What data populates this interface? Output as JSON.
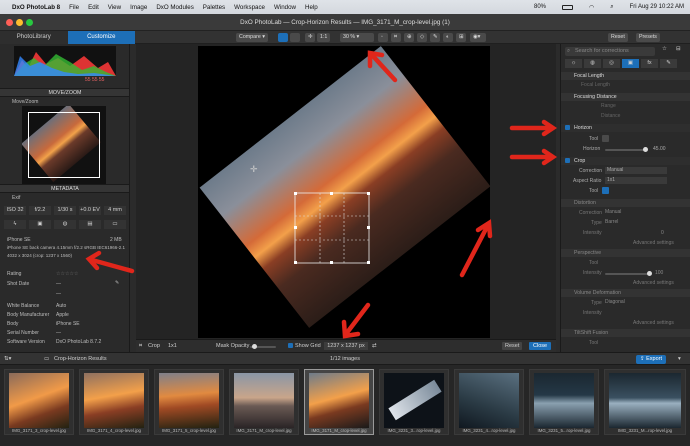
{
  "menubar": {
    "app": "DxO PhotoLab 8",
    "items": [
      "File",
      "Edit",
      "View",
      "Image",
      "DxO Modules",
      "Palettes",
      "Workspace",
      "Window",
      "Help"
    ],
    "battery": "80%",
    "clock": "Fri Aug 29  10:22 AM"
  },
  "window": {
    "title": "DxO PhotoLab — Crop-Horizon Results — IMG_3171_M_crop-level.jpg (1)"
  },
  "tabs": {
    "library": "PhotoLibrary",
    "customize": "Customize"
  },
  "toolbar": {
    "compare": "Compare",
    "one_to_one": "1:1",
    "zoom": "30 %",
    "reset": "Reset",
    "presets": "Presets"
  },
  "left": {
    "move_zoom": "MOVE/ZOOM",
    "move_zoom_sub": "Move/Zoom",
    "metadata": "METADATA",
    "exif": "Exif",
    "exif_values": [
      "ISO 32",
      "f/2.2",
      "1/30 s",
      "+0.0 EV",
      "4 mm"
    ],
    "camera": "iPhone SE",
    "size_mb": "2 MB",
    "lens": "iPhone SE back camera 4.15mm f/2.2",
    "colorspace": "sRGB IEC61966-2.1",
    "dims": "4032 x 3024 (crop: 1237 x 1560)",
    "histo_values": "55  55  55",
    "fields": [
      {
        "label": "Rating",
        "value": ""
      },
      {
        "label": "Shot Date",
        "value": "—"
      },
      {
        "label": "",
        "value": "—"
      },
      {
        "label": "White Balance",
        "value": "Auto"
      },
      {
        "label": "Body Manufacturer",
        "value": "Apple"
      },
      {
        "label": "Body",
        "value": "iPhone SE"
      },
      {
        "label": "Serial Number",
        "value": "—"
      },
      {
        "label": "Software Version",
        "value": "DxO PhotoLab 8.7.2"
      }
    ]
  },
  "right": {
    "search_placeholder": "Search for corrections",
    "focal": "Focal Length",
    "focal_row": "Focal Length",
    "focusing": "Focusing Distance",
    "focusing_rows": [
      "Range",
      "Distance"
    ],
    "horizon": "Horizon",
    "horizon_tool": "Tool",
    "horizon_label": "Horizon",
    "horizon_value": "45.00",
    "crop": "Crop",
    "crop_correction_label": "Correction",
    "crop_correction_value": "Manual",
    "crop_aspect_label": "Aspect Ratio",
    "crop_aspect_value": "1x1",
    "crop_tool": "Tool",
    "distortion": "Distortion",
    "distortion_correction": "Correction",
    "distortion_correction_value": "Manual",
    "distortion_type": "Type",
    "distortion_type_value": "Barrel",
    "distortion_intensity": "Intensity",
    "distortion_intensity_value": "0",
    "advanced": "Advanced settings",
    "perspective": "Perspective",
    "perspective_tool": "Tool",
    "perspective_intensity": "Intensity",
    "perspective_intensity_value": "100",
    "volume": "Volume Deformation",
    "volume_type": "Type",
    "volume_type_value": "Diagonal",
    "volume_intensity": "Intensity",
    "tilt": "TiltShift Fusion",
    "tilt_tool": "Tool"
  },
  "viewer_bottom": {
    "crop": "Crop",
    "ratio": "1x1",
    "mask_opacity": "Mask Opacity",
    "show_grid": "Show Grid",
    "crop_size": "1237 x 1237 px",
    "reset": "Reset",
    "close": "Close"
  },
  "filmstrip": {
    "folder": "Crop-Horizon Results",
    "count": "1/12 images",
    "export": "Export",
    "thumbs": [
      "IMG_3171_3_crop-level.jpg",
      "IMG_3171_4_crop-level.jpg",
      "IMG_3171_5_crop-level.jpg",
      "IMG_3171_M_crop-level.jpg",
      "IMG_3171_M_crop-level.jpg",
      "IMG_3231_3...rop-level.jpg",
      "IMG_3231_4...rop-level.jpg",
      "IMG_3231_5...rop-level.jpg",
      "IMG_3231_M...rop-level.jpg"
    ]
  },
  "colors": {
    "accent": "#1d6fb8",
    "annotation": "#e0261b"
  }
}
